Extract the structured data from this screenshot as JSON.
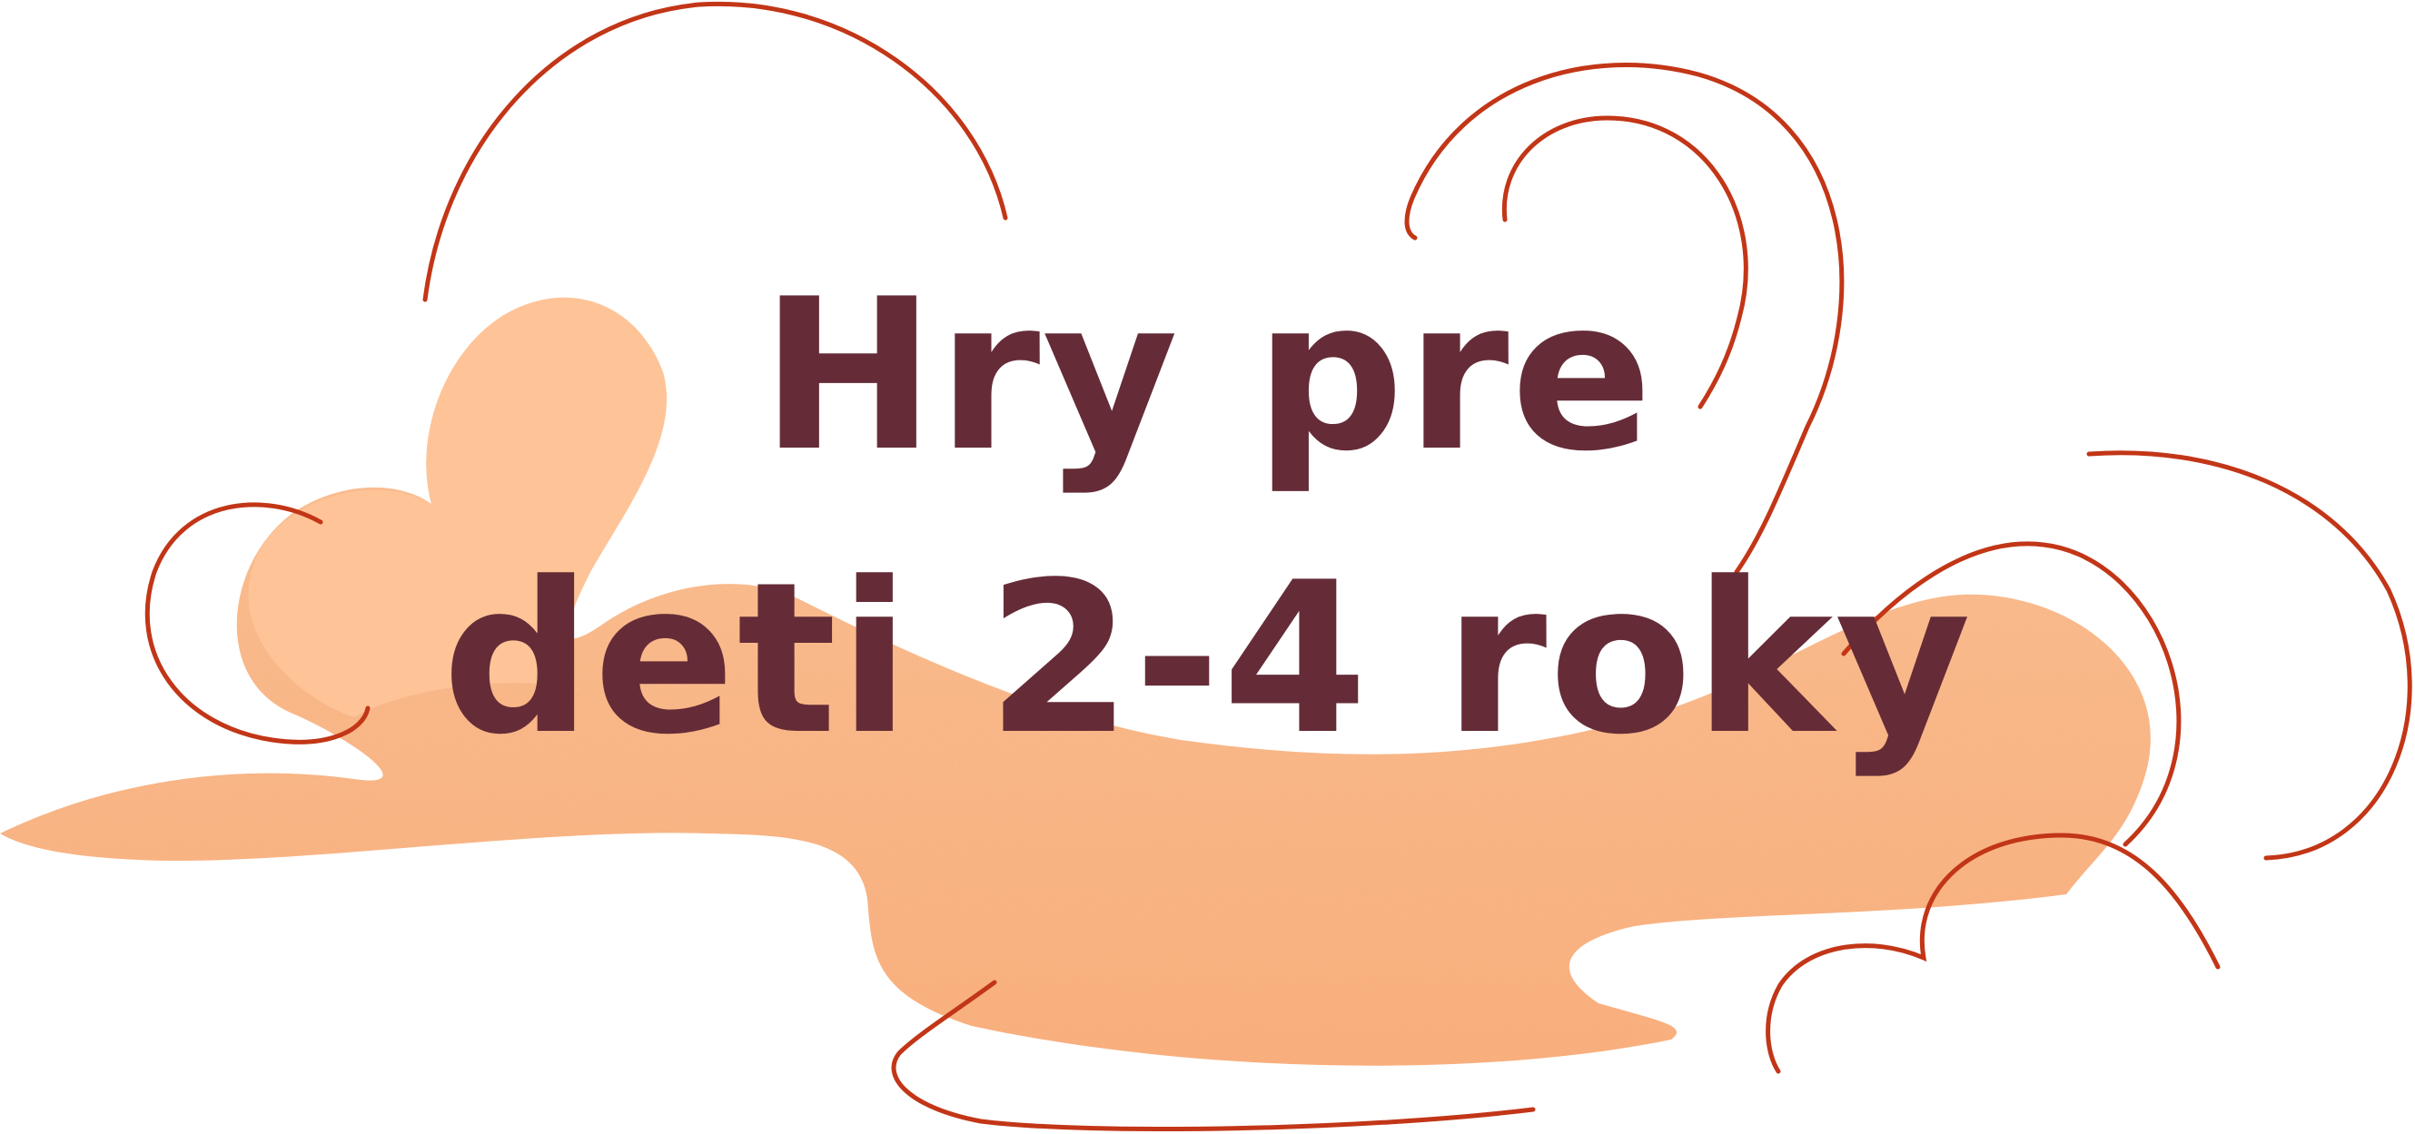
{
  "title": {
    "line1": "Hry pre",
    "line2": "deti 2-4 roky"
  },
  "colors": {
    "background": "#ffffff",
    "title_text": "#652c37",
    "blob_light": "#fec498",
    "blob_main": "#fdb27f",
    "curve_stroke": "#c23617"
  }
}
